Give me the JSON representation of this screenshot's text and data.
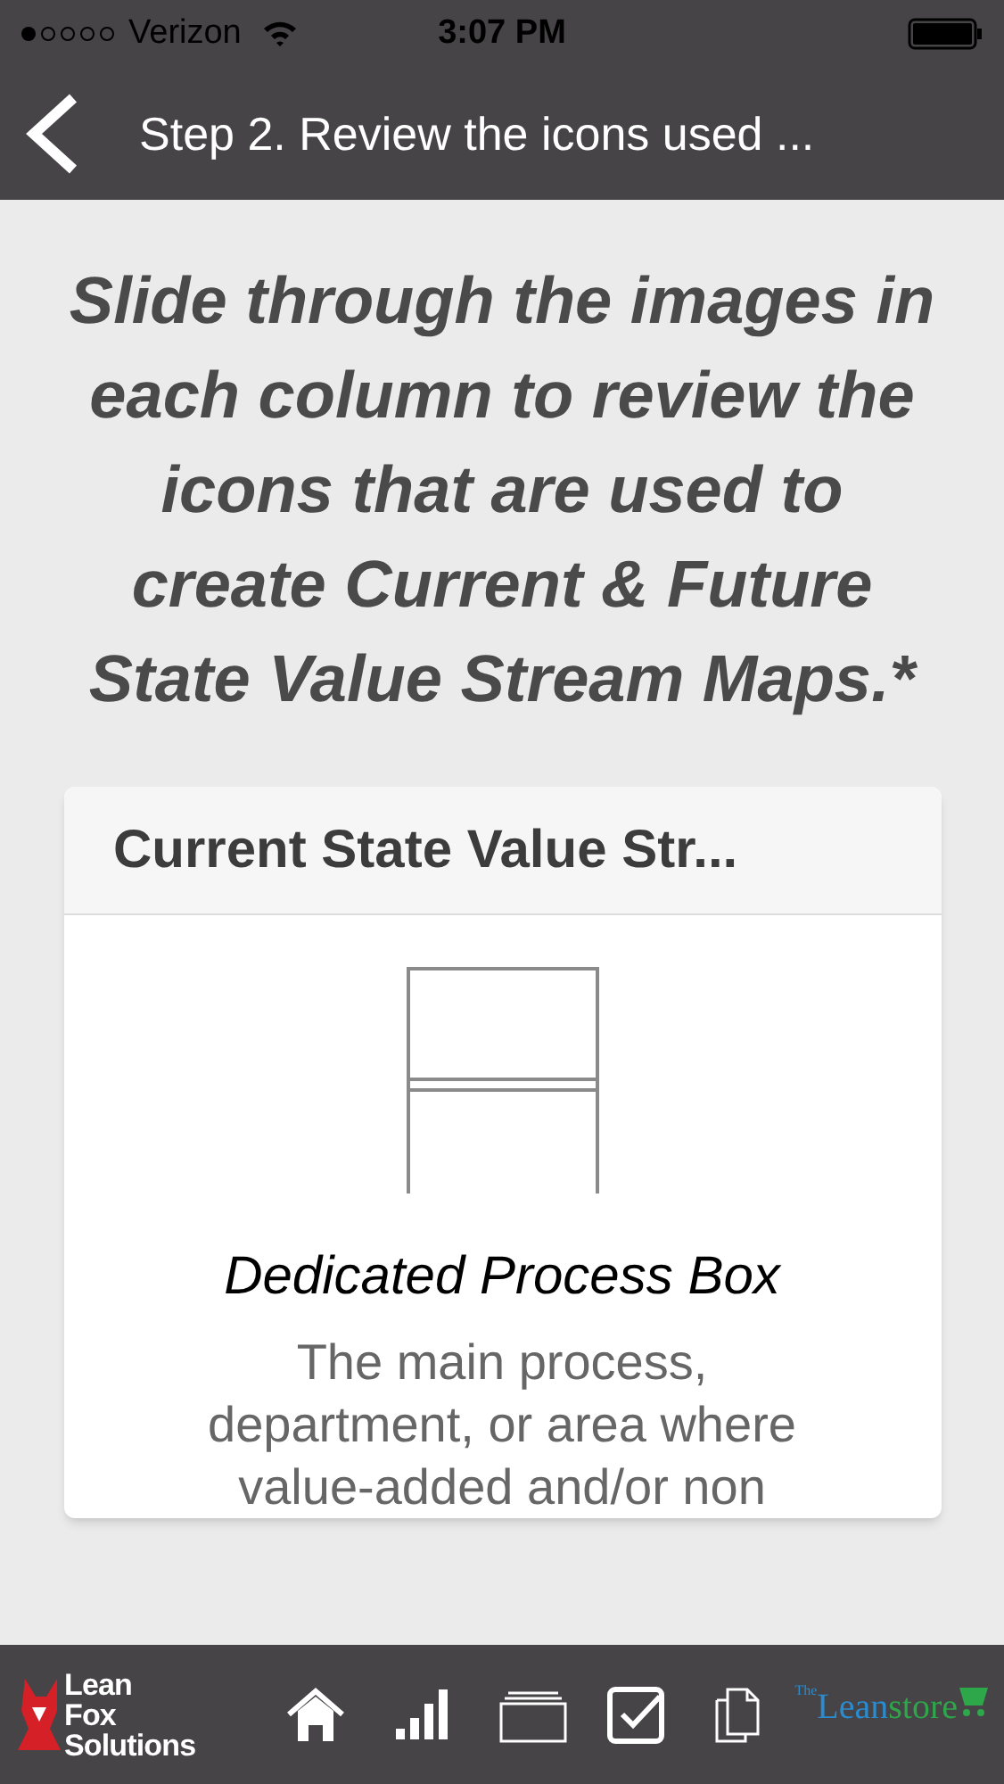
{
  "status_bar": {
    "carrier": "Verizon",
    "time": "3:07 PM"
  },
  "nav_bar": {
    "title": "Step 2. Review the icons used ..."
  },
  "intro": "Slide through the images in each column to review the icons that are used to create Current & Future State Value Stream Maps.*",
  "card": {
    "title": "Current State Value Str...",
    "icon_name": "Dedicated Process Box",
    "description": "The main process, department, or area where value-added and/or non"
  },
  "bottom_bar": {
    "left_logo": "Lean Fox Solutions",
    "right_logo_small": "The",
    "right_logo": "Lean",
    "right_logo_accent": "store",
    "tabs": [
      {
        "kind": "home"
      },
      {
        "kind": "bars"
      },
      {
        "kind": "folder"
      },
      {
        "kind": "check"
      },
      {
        "kind": "docs"
      }
    ]
  }
}
